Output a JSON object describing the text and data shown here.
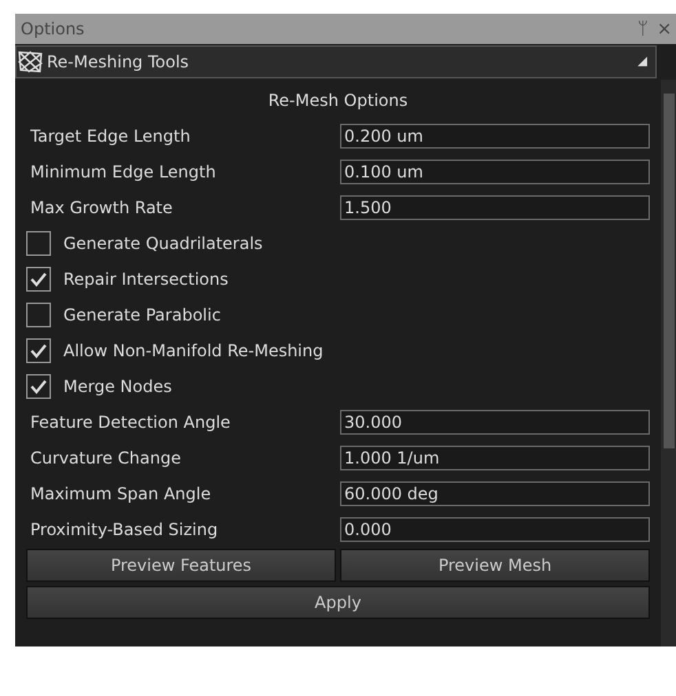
{
  "window": {
    "title": "Options",
    "pin": "ᛘ",
    "close": "×"
  },
  "dropdown": {
    "value": "Re-Meshing Tools",
    "caret": "◢"
  },
  "section_title": "Re-Mesh Options",
  "items": [
    {
      "kind": "field",
      "label": "Target Edge Length",
      "value": "0.200 um"
    },
    {
      "kind": "field",
      "label": "Minimum Edge Length",
      "value": "0.100 um"
    },
    {
      "kind": "field",
      "label": "Max Growth Rate",
      "value": "1.500"
    },
    {
      "kind": "checkbox",
      "label": "Generate Quadrilaterals",
      "checked": false
    },
    {
      "kind": "checkbox",
      "label": "Repair Intersections",
      "checked": true
    },
    {
      "kind": "checkbox",
      "label": "Generate Parabolic",
      "checked": false
    },
    {
      "kind": "checkbox",
      "label": "Allow Non-Manifold Re-Meshing",
      "checked": true
    },
    {
      "kind": "checkbox",
      "label": "Merge Nodes",
      "checked": true
    },
    {
      "kind": "field",
      "label": "Feature Detection Angle",
      "value": "30.000"
    },
    {
      "kind": "field",
      "label": "Curvature Change",
      "value": "1.000 1/um"
    },
    {
      "kind": "field",
      "label": "Maximum Span Angle",
      "value": "60.000 deg"
    },
    {
      "kind": "field",
      "label": "Proximity-Based Sizing",
      "value": "0.000"
    }
  ],
  "buttons": [
    "Preview Features",
    "Preview Mesh"
  ],
  "apply_button": "Apply"
}
